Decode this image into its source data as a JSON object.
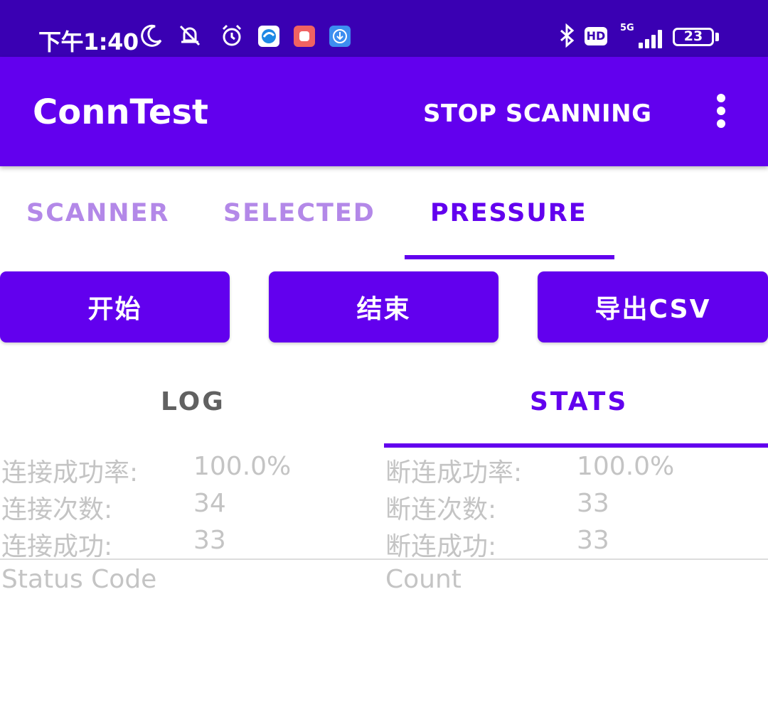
{
  "status_bar": {
    "time": "下午1:40",
    "icons": [
      "moon-icon",
      "mute-icon",
      "alarm-icon",
      "browser-app-icon",
      "red-app-icon",
      "download-app-icon",
      "bluetooth-icon",
      "signal-icon"
    ],
    "hd": "HD",
    "network": "5G",
    "battery": "23"
  },
  "app_bar": {
    "title": "ConnTest",
    "action": "STOP SCANNING",
    "overflow_icon": "more-vert-icon"
  },
  "tabs": [
    {
      "label": "SCANNER",
      "active": false
    },
    {
      "label": "SELECTED",
      "active": false
    },
    {
      "label": "PRESSURE",
      "active": true
    }
  ],
  "buttons": {
    "start": "开始",
    "end": "结束",
    "export": "导出CSV"
  },
  "sub_tabs": [
    {
      "label": "LOG",
      "active": false
    },
    {
      "label": "STATS",
      "active": true
    }
  ],
  "stats": {
    "left": [
      {
        "label": "连接成功率:",
        "value": "100.0%"
      },
      {
        "label": "连接次数:",
        "value": "34"
      },
      {
        "label": "连接成功:",
        "value": "33"
      }
    ],
    "right": [
      {
        "label": "断连成功率:",
        "value": "100.0%"
      },
      {
        "label": "断连次数:",
        "value": "33"
      },
      {
        "label": "断连成功:",
        "value": "33"
      }
    ]
  },
  "table": {
    "headers": [
      "Status Code",
      "Count"
    ]
  },
  "colors": {
    "primary": "#6200ee",
    "status_bar": "#3a00b3",
    "tab_inactive": "#b388e8",
    "text_faded": "#c4c4c4"
  }
}
